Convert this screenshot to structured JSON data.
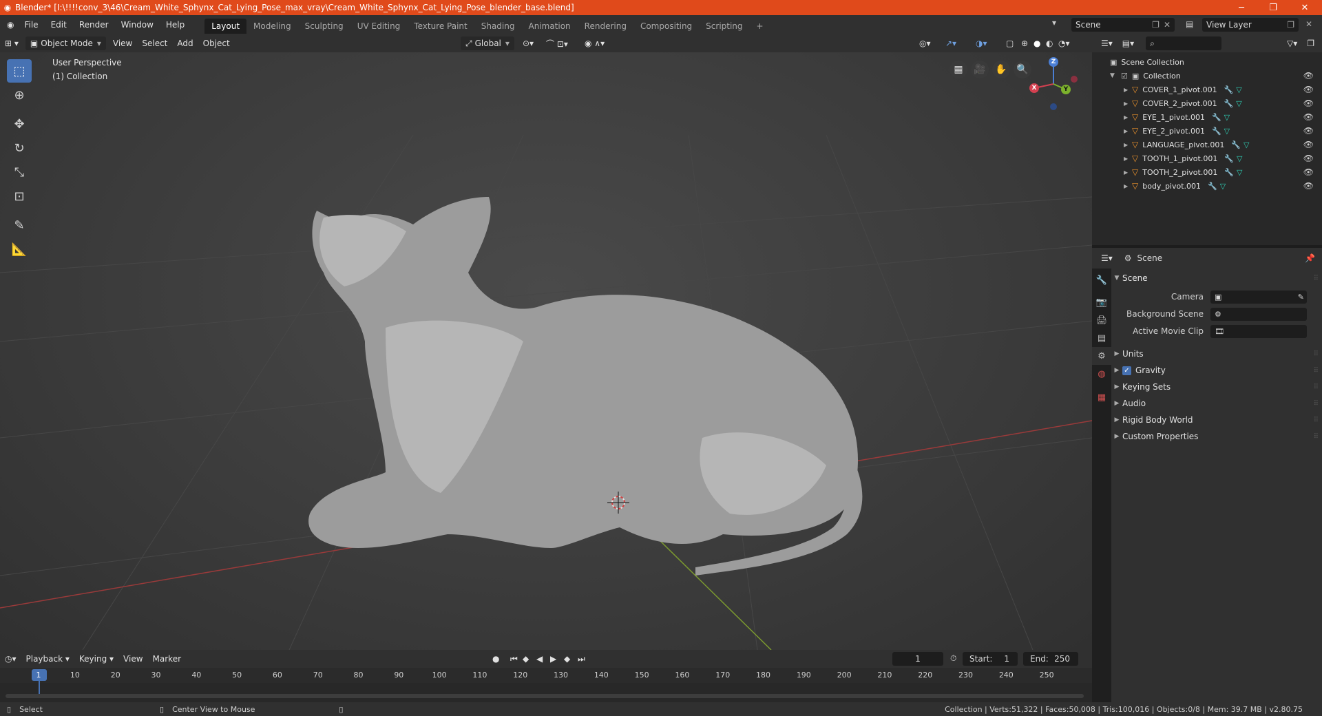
{
  "titlebar": {
    "title": "Blender* [I:\\!!!!conv_3\\46\\Cream_White_Sphynx_Cat_Lying_Pose_max_vray\\Cream_White_Sphynx_Cat_Lying_Pose_blender_base.blend]",
    "minimize": "─",
    "restore": "❐",
    "close": "✕"
  },
  "menu": [
    "File",
    "Edit",
    "Render",
    "Window",
    "Help"
  ],
  "workspaces": [
    "Layout",
    "Modeling",
    "Sculpting",
    "UV Editing",
    "Texture Paint",
    "Shading",
    "Animation",
    "Rendering",
    "Compositing",
    "Scripting"
  ],
  "active_workspace": "Layout",
  "add_workspace": "+",
  "scene_selector": "Scene",
  "view_layer": "View Layer",
  "viewport_header": {
    "mode": "Object Mode",
    "view": "View",
    "select": "Select",
    "add": "Add",
    "object": "Object",
    "orientation": "Global"
  },
  "viewport": {
    "perspective": "User Perspective",
    "collection": "(1) Collection",
    "gizmo": {
      "x": "X",
      "y": "Y",
      "z": "Z"
    }
  },
  "outliner": {
    "root": "Scene Collection",
    "collection": "Collection",
    "objects": [
      "COVER_1_pivot.001",
      "COVER_2_pivot.001",
      "EYE_1_pivot.001",
      "EYE_2_pivot.001",
      "LANGUAGE_pivot.001",
      "TOOTH_1_pivot.001",
      "TOOTH_2_pivot.001",
      "body_pivot.001"
    ]
  },
  "properties": {
    "context": "Scene",
    "panel_title": "Scene",
    "camera_label": "Camera",
    "background_scene_label": "Background Scene",
    "active_movie_clip_label": "Active Movie Clip",
    "subpanels": [
      "Units",
      "Gravity",
      "Keying Sets",
      "Audio",
      "Rigid Body World",
      "Custom Properties"
    ],
    "gravity_checked": true
  },
  "timeline": {
    "playback": "Playback",
    "keying": "Keying",
    "view": "View",
    "marker": "Marker",
    "current_frame": "1",
    "start_label": "Start:",
    "start": "1",
    "end_label": "End:",
    "end": "250",
    "ruler": [
      "1",
      "10",
      "20",
      "30",
      "40",
      "50",
      "60",
      "70",
      "80",
      "90",
      "100",
      "110",
      "120",
      "130",
      "140",
      "150",
      "160",
      "170",
      "180",
      "190",
      "200",
      "210",
      "220",
      "230",
      "240",
      "250"
    ]
  },
  "statusbar": {
    "select": "Select",
    "center_view": "Center View to Mouse",
    "stats": "Collection | Verts:51,322 | Faces:50,008 | Tris:100,016 | Objects:0/8 | Mem: 39.7 MB | v2.80.75"
  }
}
